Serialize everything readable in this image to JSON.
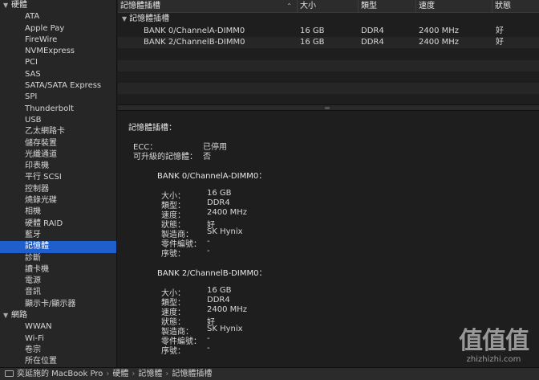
{
  "sidebar": {
    "groups": [
      {
        "label": "硬體",
        "items": [
          "ATA",
          "Apple Pay",
          "FireWire",
          "NVMExpress",
          "PCI",
          "SAS",
          "SATA/SATA Express",
          "SPI",
          "Thunderbolt",
          "USB",
          "乙太網路卡",
          "儲存裝置",
          "光纖通道",
          "印表機",
          "平行 SCSI",
          "控制器",
          "燒錄光碟",
          "相機",
          "硬體 RAID",
          "藍牙",
          "記憶體",
          "診斷",
          "讀卡機",
          "電源",
          "音訊",
          "顯示卡/顯示器"
        ]
      },
      {
        "label": "網路",
        "items": [
          "WWAN",
          "Wi-Fi",
          "卷宗",
          "所在位置"
        ]
      }
    ],
    "selected": "記憶體"
  },
  "table": {
    "headers": [
      "記憶體插槽",
      "大小",
      "類型",
      "速度",
      "狀態"
    ],
    "group_label": "記憶體插槽",
    "rows": [
      [
        "BANK 0/ChannelA-DIMM0",
        "16 GB",
        "DDR4",
        "2400 MHz",
        "好"
      ],
      [
        "BANK 2/ChannelB-DIMM0",
        "16 GB",
        "DDR4",
        "2400 MHz",
        "好"
      ]
    ]
  },
  "detail": {
    "title": "記憶體插槽：",
    "summary": [
      {
        "label": "ECC：",
        "value": "已停用"
      },
      {
        "label": "可升級的記憶體：",
        "value": "否"
      }
    ],
    "banks": [
      {
        "name": "BANK 0/ChannelA-DIMM0：",
        "fields": [
          {
            "label": "大小：",
            "value": "16 GB"
          },
          {
            "label": "類型：",
            "value": "DDR4"
          },
          {
            "label": "速度：",
            "value": "2400 MHz"
          },
          {
            "label": "狀態：",
            "value": "好"
          },
          {
            "label": "製造商：",
            "value": "SK Hynix"
          },
          {
            "label": "零件編號：",
            "value": "-"
          },
          {
            "label": "序號：",
            "value": "-"
          }
        ]
      },
      {
        "name": "BANK 2/ChannelB-DIMM0：",
        "fields": [
          {
            "label": "大小：",
            "value": "16 GB"
          },
          {
            "label": "類型：",
            "value": "DDR4"
          },
          {
            "label": "速度：",
            "value": "2400 MHz"
          },
          {
            "label": "狀態：",
            "value": "好"
          },
          {
            "label": "製造商：",
            "value": "SK Hynix"
          },
          {
            "label": "零件編號：",
            "value": "-"
          },
          {
            "label": "序號：",
            "value": "-"
          }
        ]
      }
    ]
  },
  "statusbar": {
    "path": [
      "奕延施的 MacBook Pro",
      "硬體",
      "記憶體",
      "記憶體插槽"
    ],
    "separator": "›"
  },
  "watermark": {
    "big": "值值值",
    "small": "zhizhizhi.com"
  },
  "colors": {
    "selection": "#1f5fcc",
    "background": "#1e1e1e",
    "sidebar": "#262626"
  }
}
